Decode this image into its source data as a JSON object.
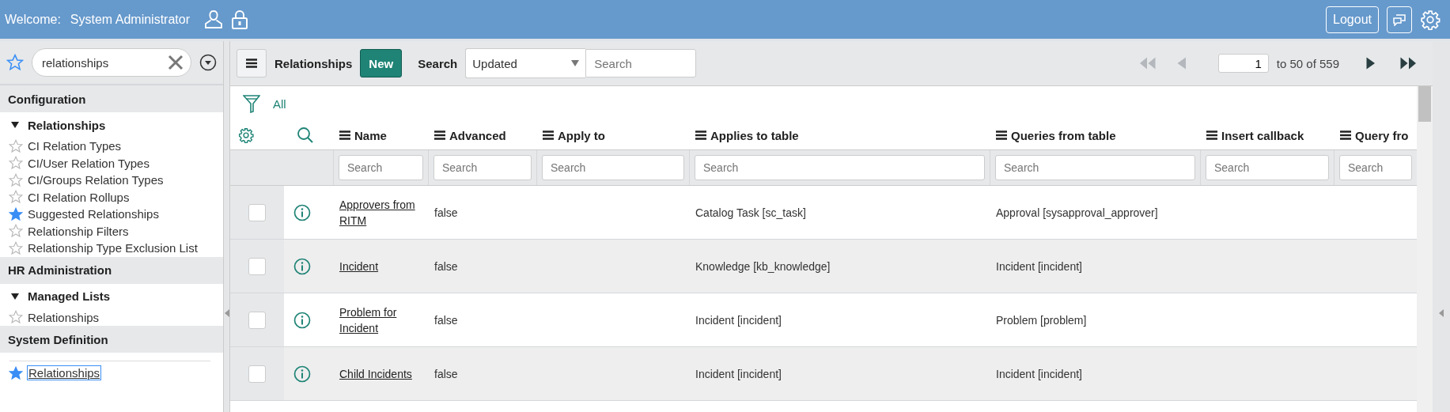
{
  "top_bar": {
    "welcome_label": "Welcome:",
    "user_name": "System Administrator",
    "logout_button": "Logout"
  },
  "navigator": {
    "filter_value": "relationships",
    "sections": [
      {
        "title": "Configuration",
        "children": [
          {
            "kind": "group",
            "label": "Relationships",
            "expanded": true,
            "children": [
              {
                "label": "CI Relation Types",
                "favorite": false,
                "selected": false
              },
              {
                "label": "CI/User Relation Types",
                "favorite": false,
                "selected": false
              },
              {
                "label": "CI/Groups Relation Types",
                "favorite": false,
                "selected": false
              },
              {
                "label": "CI Relation Rollups",
                "favorite": false,
                "selected": false
              },
              {
                "label": "Suggested Relationships",
                "favorite": true,
                "selected": false
              },
              {
                "label": "Relationship Filters",
                "favorite": false,
                "selected": false
              },
              {
                "label": "Relationship Type Exclusion List",
                "favorite": false,
                "selected": false
              }
            ]
          }
        ]
      },
      {
        "title": "HR Administration",
        "children": [
          {
            "kind": "group",
            "label": "Managed Lists",
            "expanded": true,
            "children": [
              {
                "label": "Relationships",
                "favorite": false,
                "selected": false
              }
            ]
          }
        ]
      },
      {
        "title": "System Definition",
        "children": [
          {
            "kind": "module",
            "label": "Relationships",
            "favorite": true,
            "selected": true
          }
        ]
      }
    ]
  },
  "list": {
    "title": "Relationships",
    "new_button": "New",
    "search_label": "Search",
    "search_field": {
      "value": "Updated"
    },
    "search_input": {
      "placeholder": "Search"
    },
    "pager": {
      "page": "1",
      "range": "to 50 of 559",
      "buttons": [
        {
          "kind": "first",
          "disabled": true
        },
        {
          "kind": "prev",
          "disabled": true
        },
        {
          "kind": "next",
          "disabled": false
        },
        {
          "kind": "last",
          "disabled": false
        }
      ]
    },
    "filter_breadcrumb": "All",
    "columns": [
      {
        "label": "Name",
        "placeholder": "Search"
      },
      {
        "label": "Advanced",
        "placeholder": "Search"
      },
      {
        "label": "Apply to",
        "placeholder": "Search"
      },
      {
        "label": "Applies to table",
        "placeholder": "Search"
      },
      {
        "label": "Queries from table",
        "placeholder": "Search"
      },
      {
        "label": "Insert callback",
        "placeholder": "Search"
      },
      {
        "label": "Query fro",
        "placeholder": "Search"
      }
    ],
    "rows": [
      {
        "checked": false,
        "name": "Approvers from RITM",
        "advanced": "false",
        "applies_to_table": "Catalog Task [sc_task]",
        "queries_from_table": "Approval [sysapproval_approver]"
      },
      {
        "checked": false,
        "name": "Incident",
        "advanced": "false",
        "applies_to_table": "Knowledge [kb_knowledge]",
        "queries_from_table": "Incident [incident]"
      },
      {
        "checked": false,
        "name": "Problem for Incident",
        "advanced": "false",
        "applies_to_table": "Incident [incident]",
        "queries_from_table": "Problem [problem]"
      },
      {
        "checked": false,
        "name": "Child Incidents",
        "advanced": "false",
        "applies_to_table": "Incident [incident]",
        "queries_from_table": "Incident [incident]"
      }
    ]
  }
}
